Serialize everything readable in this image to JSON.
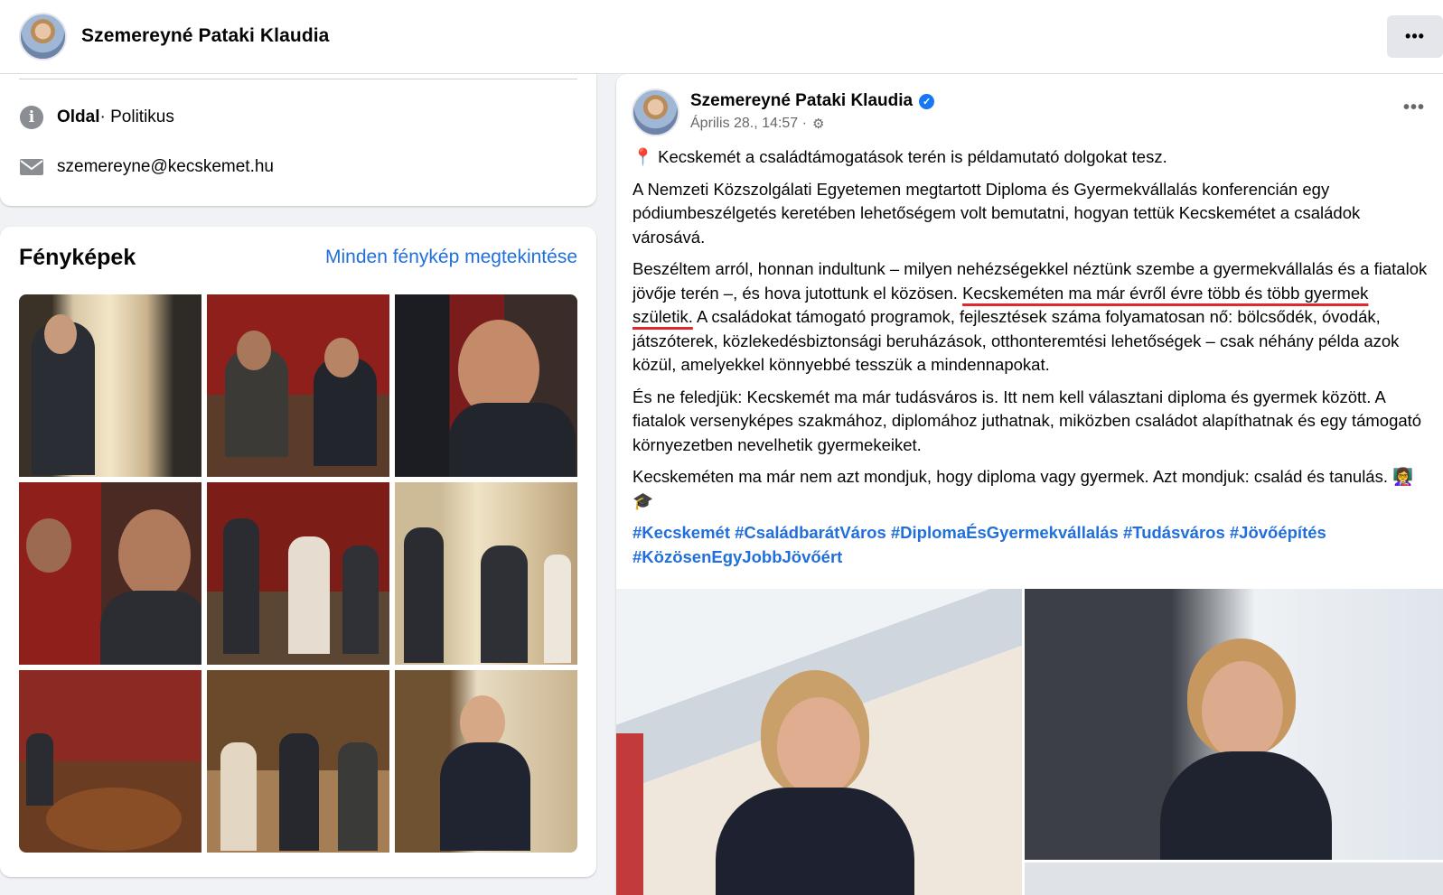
{
  "page": {
    "name": "Szemereyné Pataki Klaudia",
    "more_icon": "more-horizontal-icon"
  },
  "intro": {
    "category_bold": "Oldal",
    "category_rest": " · Politikus",
    "email": "szemereyne@kecskemet.hu"
  },
  "photos": {
    "title": "Fényképek",
    "see_all": "Minden fénykép megtekintése",
    "count": 9
  },
  "post": {
    "author": "Szemereyné Pataki Klaudia",
    "timestamp": "Április 28., 14:57 ·",
    "paragraphs": {
      "p1": "📍 Kecskemét a családtámogatások terén is példamutató dolgokat tesz.",
      "p2": "A Nemzeti Közszolgálati Egyetemen megtartott Diploma és Gyermekvállalás konferencián egy pódiumbeszélgetés keretében lehetőségem volt bemutatni, hogyan tettük Kecskemétet a családok városává.",
      "p3_a": "Beszéltem arról, honnan indultunk – milyen nehézségekkel néztünk szembe a gyermekvállalás és a fiatalok jövője terén –, és hova jutottunk el közösen. ",
      "p3_highlight": "Kecskeméten ma már évről évre több és több gyermek születik.",
      "p3_b": " A családokat támogató programok, fejlesztések száma folyamatosan nő: bölcsődék, óvodák, játszóterek, közlekedésbiztonsági beruházások, otthonteremtési lehetőségek – csak néhány példa azok közül, amelyekkel könnyebbé tesszük a mindennapokat.",
      "p4": "És ne feledjük: Kecskemét ma már tudásváros is. Itt nem kell választani diploma és gyermek között. A fiatalok versenyképes szakmához, diplomához juthatnak, miközben családot alapíthatnak és egy támogató környezetben nevelhetik gyermekeiket.",
      "p5": "Kecskeméten ma már nem azt mondjuk, hogy diploma vagy gyermek. Azt mondjuk: család és tanulás. 👩‍🏫🎓",
      "hashtags": "#Kecskemét #CsaládbarátVáros #DiplomaÉsGyermekvállalás #Tudásváros #Jövőépítés #KözösenEgyJobbJövőért"
    }
  },
  "colors": {
    "link": "#216fdb",
    "underline": "#e0282e",
    "verified": "#1877f2"
  }
}
